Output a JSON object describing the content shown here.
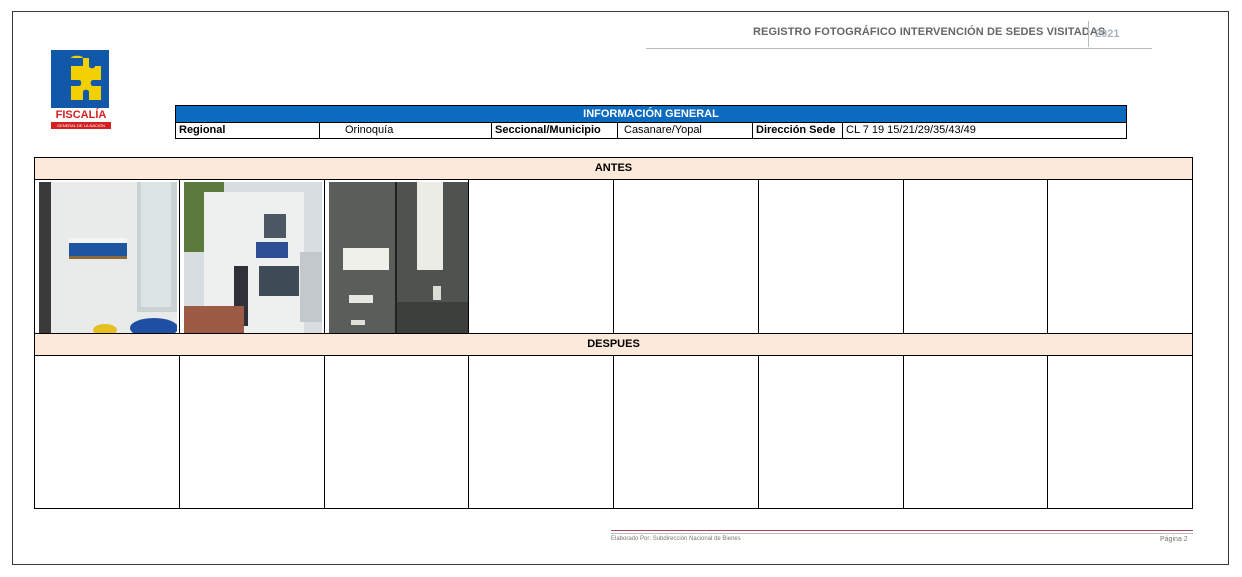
{
  "header": {
    "title": "REGISTRO FOTOGRÁFICO INTERVENCIÓN DE SEDES VISITADAS",
    "year": "2021"
  },
  "logo": {
    "name": "FISCALÍA",
    "subtitle": "GENERAL DE LA NACIÓN",
    "colors": {
      "blue": "#1158a8",
      "yellow": "#f5d000",
      "red": "#d32020"
    }
  },
  "info": {
    "heading": "INFORMACIÓN GENERAL",
    "regional_label": "Regional",
    "regional_value": "Orinoquía",
    "seccional_label": "Seccional/Municipio",
    "seccional_value": "Casanare/Yopal",
    "direccion_label": "Dirección Sede",
    "direccion_value": "CL 7 19 15/21/29/35/43/49"
  },
  "sections": {
    "antes": "ANTES",
    "despues": "DESPUES"
  },
  "footer": {
    "prepared_by": "Elaborado Por: Subdirección Nacional de Bienes",
    "page": "Página 2"
  },
  "colors": {
    "info_header_bg": "#0d6bbf",
    "section_header_bg": "#fde9d9"
  }
}
